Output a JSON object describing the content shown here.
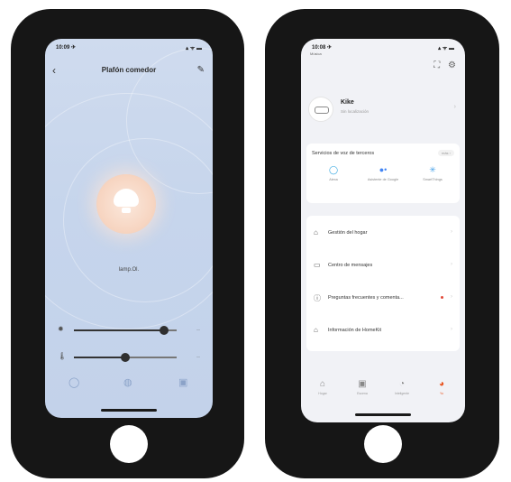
{
  "left_screen": {
    "status": {
      "time": "10:09 ✈",
      "signal": "▴ ᯤ ▬"
    },
    "header": {
      "back_icon": "chevron-left-icon",
      "title": "Plafón comedor",
      "edit_icon": "pencil-icon"
    },
    "device": {
      "label": "lamp-icon",
      "state_label": "lamp.Ol."
    },
    "sliders": [
      {
        "icon": "brightness-icon",
        "value": 0.88,
        "value_label": "—"
      },
      {
        "icon": "temperature-icon",
        "value": 0.5,
        "value_label": "—"
      }
    ],
    "tabs": [
      {
        "icon": "power-icon"
      },
      {
        "icon": "timer-icon"
      },
      {
        "icon": "schedule-icon"
      }
    ]
  },
  "right_screen": {
    "status": {
      "time": "10:08 ✈",
      "sub": "Música",
      "signal": "▴ ᯤ ▬"
    },
    "top_icons": [
      "scan-icon",
      "settings-icon"
    ],
    "profile": {
      "name": "Kike",
      "subtitle": "Sin localización"
    },
    "voice_services": {
      "title": "Servicios de voz de terceros",
      "more_label": "más ›",
      "items": [
        {
          "name": "Alexa",
          "icon": "alexa-icon",
          "color": "#2fa5e0"
        },
        {
          "name": "Asistente de Google",
          "icon": "google-assistant-icon",
          "color": "#4285f4"
        },
        {
          "name": "SmartThings",
          "icon": "smartthings-icon",
          "color": "#4aa3e8"
        }
      ]
    },
    "menu": [
      {
        "label": "Gestión del hogar",
        "icon": "home-icon"
      },
      {
        "label": "Centro de mensajes",
        "icon": "message-icon"
      },
      {
        "label": "Preguntas frecuentes y comenta...",
        "icon": "help-icon",
        "dot": true
      },
      {
        "label": "Información de HomeKit",
        "icon": "homekit-icon"
      }
    ],
    "tabs": [
      {
        "label": "Hogar",
        "icon": "home-tab-icon"
      },
      {
        "label": "Escena",
        "icon": "scene-tab-icon"
      },
      {
        "label": "Inteligente",
        "icon": "smart-tab-icon"
      },
      {
        "label": "Yo",
        "icon": "me-tab-icon",
        "active": true
      }
    ]
  }
}
